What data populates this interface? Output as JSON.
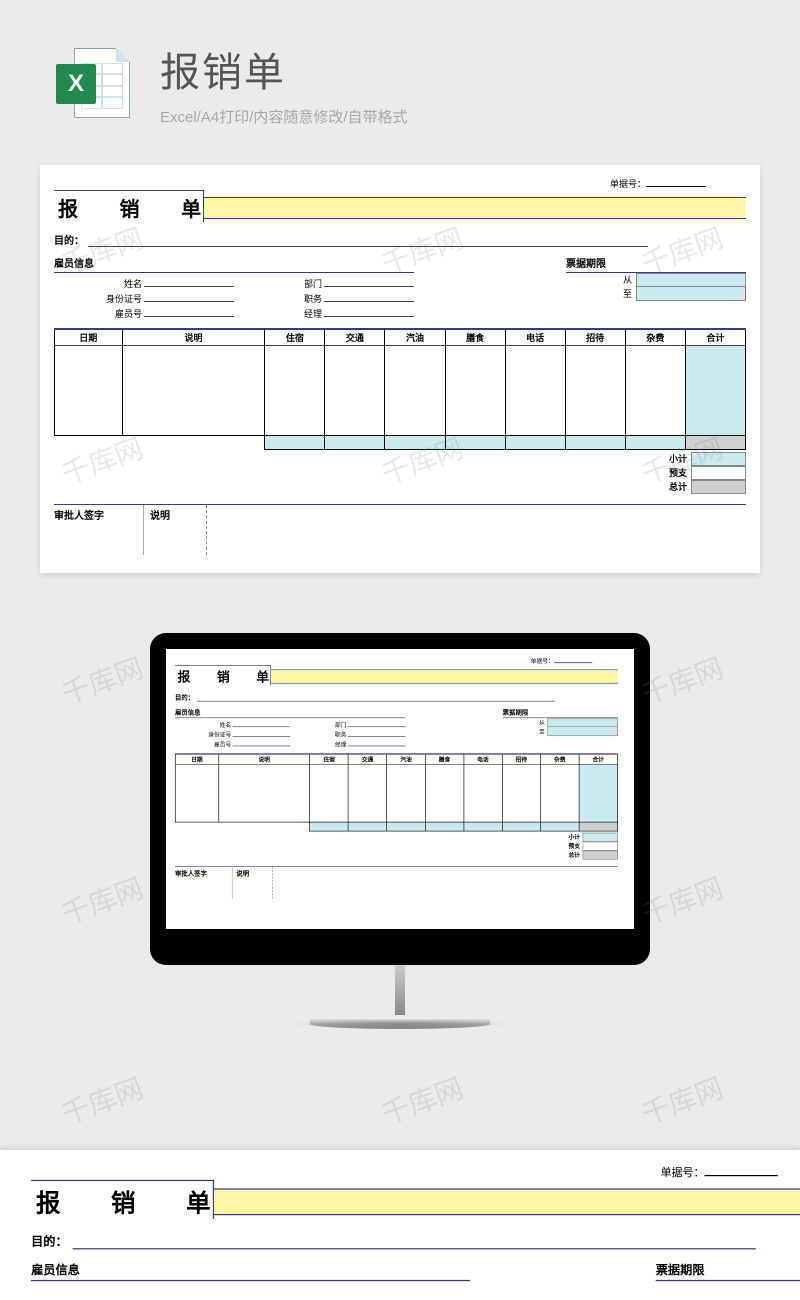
{
  "header": {
    "title": "报销单",
    "subtitle": "Excel/A4打印/内容随意修改/自带格式",
    "icon_letter": "X"
  },
  "form": {
    "doc_no_label": "单据号：",
    "title": "报 销 单",
    "purpose_label": "目的：",
    "employee_section": "雇员信息",
    "fields": {
      "name": "姓名",
      "dept": "部门",
      "id": "身份证号",
      "position": "职务",
      "emp_no": "雇员号",
      "manager": "经理"
    },
    "period_section": "票据期限",
    "period_from": "从",
    "period_to": "至",
    "columns": {
      "date": "日期",
      "desc": "说明",
      "lodging": "住宿",
      "transport": "交通",
      "fuel": "汽油",
      "meals": "膳食",
      "phone": "电话",
      "entertain": "招待",
      "misc": "杂费",
      "total": "合计"
    },
    "summary": {
      "subtotal": "小计",
      "advance": "预支",
      "grand": "总计"
    },
    "approval": {
      "signer": "审批人签字",
      "note": "说明"
    }
  },
  "watermark": "千库网",
  "colors": {
    "yellow": "#fcf6a6",
    "cyan": "#c9ebf0",
    "navy": "#3b3b7a"
  }
}
